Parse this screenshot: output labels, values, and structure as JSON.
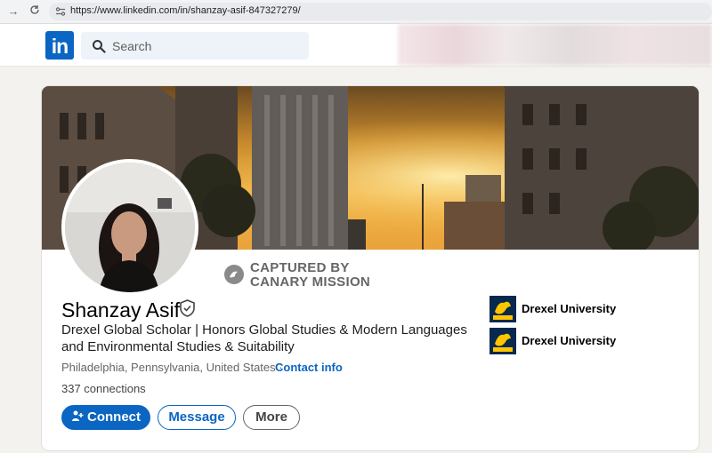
{
  "browser": {
    "back_icon": "arrow-right-icon",
    "reload_icon": "reload-icon",
    "url": "https://www.linkedin.com/in/shanzay-asif-847327279/"
  },
  "header": {
    "logo_text": "in",
    "search_placeholder": "Search"
  },
  "watermark": {
    "line1": "CAPTURED BY",
    "line2": "CANARY MISSION"
  },
  "profile": {
    "name": "Shanzay Asif",
    "headline": "Drexel Global Scholar | Honors Global Studies & Modern Languages and Environmental Studies & Suitability",
    "location": "Philadelphia, Pennsylvania, United States · ",
    "contact_label": "Contact info",
    "connections": "337 connections"
  },
  "actions": {
    "connect": "Connect",
    "message": "Message",
    "more": "More"
  },
  "education": [
    {
      "name": "Drexel University"
    },
    {
      "name": "Drexel University"
    }
  ],
  "colors": {
    "brand": "#0a66c2",
    "drexel_navy": "#07294d",
    "drexel_gold": "#ffc600"
  }
}
